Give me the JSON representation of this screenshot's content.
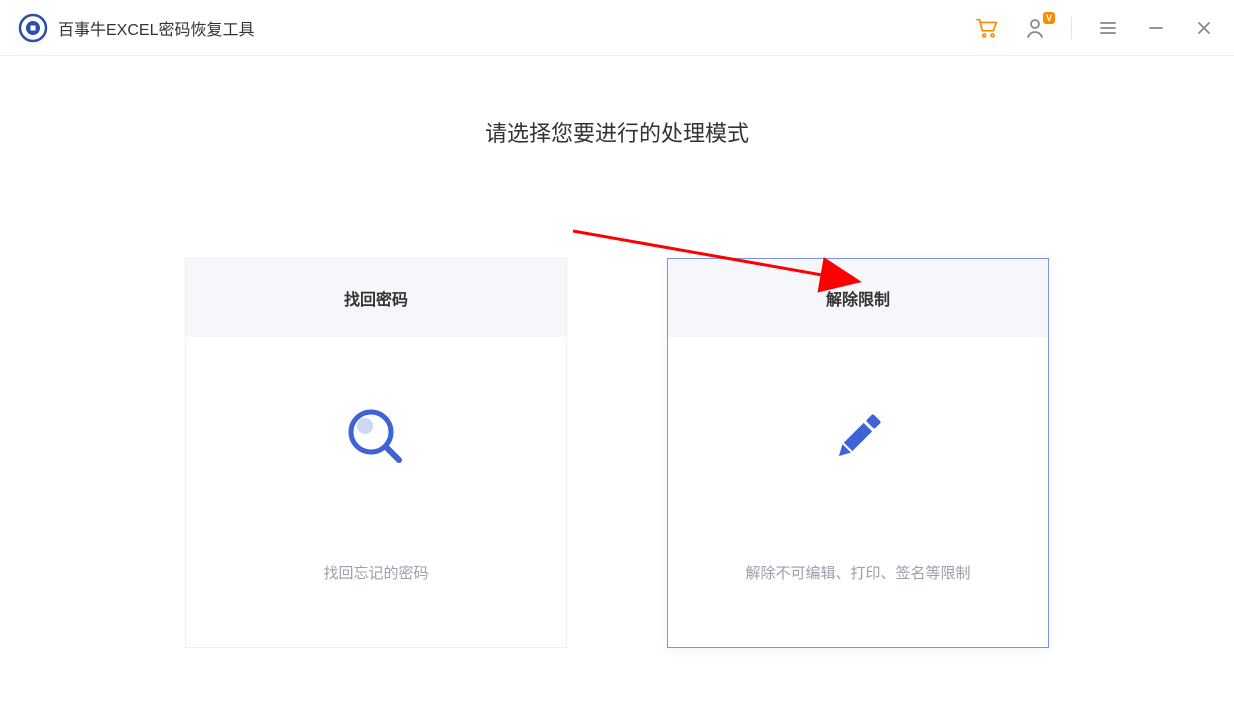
{
  "app": {
    "title": "百事牛EXCEL密码恢复工具"
  },
  "titlebar": {
    "user_badge": "V"
  },
  "main": {
    "heading": "请选择您要进行的处理模式"
  },
  "cards": [
    {
      "title": "找回密码",
      "description": "找回忘记的密码",
      "selected": false
    },
    {
      "title": "解除限制",
      "description": "解除不可编辑、打印、签名等限制",
      "selected": true
    }
  ]
}
